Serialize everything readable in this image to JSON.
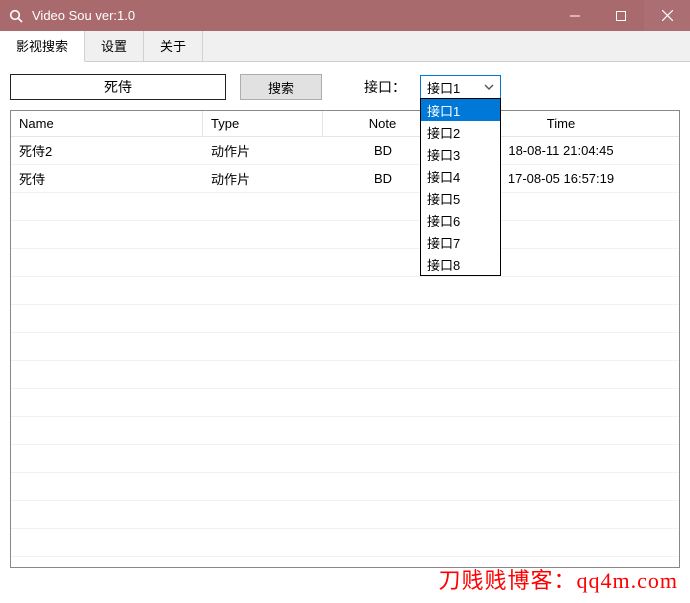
{
  "window": {
    "title": "Video Sou  ver:1.0"
  },
  "tabs": [
    {
      "label": "影视搜索",
      "active": true
    },
    {
      "label": "设置",
      "active": false
    },
    {
      "label": "关于",
      "active": false
    }
  ],
  "toolbar": {
    "search_value": "死侍",
    "search_btn": "搜索",
    "api_label": "接口：",
    "selected_api": "接口1",
    "api_options": [
      "接口1",
      "接口2",
      "接口3",
      "接口4",
      "接口5",
      "接口6",
      "接口7",
      "接口8"
    ]
  },
  "grid": {
    "headers": {
      "name": "Name",
      "type": "Type",
      "note": "Note",
      "time": "Time"
    },
    "rows": [
      {
        "name": "死侍2",
        "type": "动作片",
        "note": "BD",
        "time": "18-08-11 21:04:45"
      },
      {
        "name": "死侍",
        "type": "动作片",
        "note": "BD",
        "time": "17-08-05 16:57:19"
      }
    ]
  },
  "watermark": "刀贱贱博客：qq4m.com"
}
